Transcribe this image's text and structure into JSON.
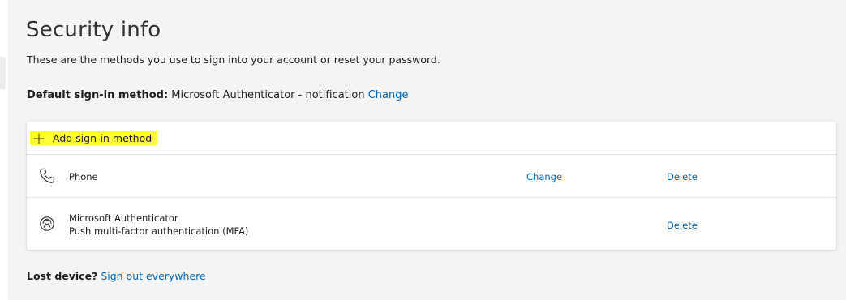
{
  "page": {
    "title": "Security info",
    "subtitle": "These are the methods you use to sign into your account or reset your password."
  },
  "default_method": {
    "label": "Default sign-in method:",
    "value": "Microsoft Authenticator - notification",
    "change_link": "Change"
  },
  "add_method": {
    "label": "Add sign-in method",
    "icon": "plus-icon",
    "highlight_color": "#ffff33"
  },
  "methods": [
    {
      "name": "Phone",
      "icon": "phone-icon",
      "change_label": "Change",
      "delete_label": "Delete"
    },
    {
      "name": "Microsoft Authenticator",
      "detail": "Push multi-factor authentication (MFA)",
      "icon": "authenticator-icon",
      "delete_label": "Delete"
    }
  ],
  "lost_device": {
    "label": "Lost device?",
    "link": "Sign out everywhere"
  },
  "colors": {
    "link": "#0067b8",
    "background": "#f4f4f4",
    "card": "#ffffff"
  }
}
